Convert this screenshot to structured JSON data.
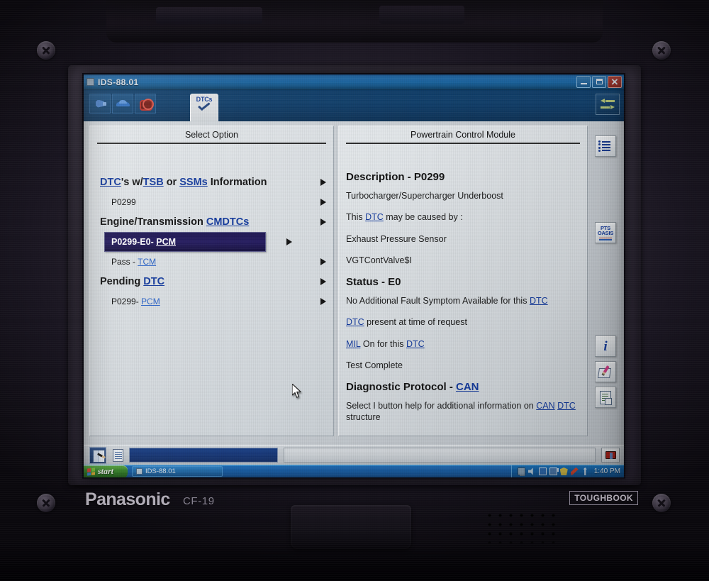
{
  "device": {
    "brand": "Panasonic",
    "model": "CF-19",
    "line": "TOUGHBOOK"
  },
  "window": {
    "title": "IDS-88.01",
    "controls": {
      "minimize": "minimize",
      "restore": "restore",
      "close": "close"
    }
  },
  "toolbar": {
    "buttons": [
      {
        "name": "vehicle-connection",
        "icon": "plug-icon"
      },
      {
        "name": "vehicle-select",
        "icon": "car-icon"
      },
      {
        "name": "engine-diagnostics",
        "icon": "engine-icon"
      }
    ],
    "tab": {
      "label": "DTCs",
      "icon": "checkmark-icon"
    },
    "nav": {
      "label": "back-forward",
      "icon": "back-forward-arrows-icon"
    }
  },
  "left_panel": {
    "title": "Select Option",
    "rows": [
      {
        "type": "head",
        "selected": false,
        "parts": [
          {
            "text": "DTC",
            "link": true
          },
          {
            "text": "'s w/",
            "link": false
          },
          {
            "text": "TSB",
            "link": true
          },
          {
            "text": " or ",
            "link": false
          },
          {
            "text": "SSMs",
            "link": true
          },
          {
            "text": " Information",
            "link": false
          }
        ]
      },
      {
        "type": "sub",
        "selected": false,
        "parts": [
          {
            "text": "P0299",
            "link": false
          }
        ]
      },
      {
        "type": "head",
        "selected": false,
        "parts": [
          {
            "text": "Engine/Transmission ",
            "link": false
          },
          {
            "text": "CMDTCs",
            "link": true
          }
        ]
      },
      {
        "type": "sub",
        "selected": true,
        "parts": [
          {
            "text": "P0299-E0- ",
            "link": false
          },
          {
            "text": "PCM",
            "link": true
          }
        ]
      },
      {
        "type": "sub",
        "selected": false,
        "parts": [
          {
            "text": "Pass - ",
            "link": false
          },
          {
            "text": "TCM",
            "link": true
          }
        ]
      },
      {
        "type": "head",
        "selected": false,
        "parts": [
          {
            "text": "Pending ",
            "link": false
          },
          {
            "text": "DTC",
            "link": true
          }
        ]
      },
      {
        "type": "sub",
        "selected": false,
        "parts": [
          {
            "text": "P0299- ",
            "link": false
          },
          {
            "text": "PCM",
            "link": true
          }
        ]
      }
    ]
  },
  "right_panel": {
    "title": "Powertrain Control Module",
    "blocks": [
      {
        "style": "heading",
        "parts": [
          {
            "text": "Description - P0299",
            "link": false
          }
        ]
      },
      {
        "style": "body",
        "parts": [
          {
            "text": "Turbocharger/Supercharger Underboost",
            "link": false
          }
        ]
      },
      {
        "style": "body",
        "parts": [
          {
            "text": "This ",
            "link": false
          },
          {
            "text": "DTC",
            "link": true
          },
          {
            "text": " may be caused by :",
            "link": false
          }
        ]
      },
      {
        "style": "body",
        "parts": [
          {
            "text": "Exhaust Pressure Sensor",
            "link": false
          }
        ]
      },
      {
        "style": "body",
        "parts": [
          {
            "text": "VGTContValve$I",
            "link": false
          }
        ]
      },
      {
        "style": "heading",
        "parts": [
          {
            "text": "Status - E0",
            "link": false
          }
        ]
      },
      {
        "style": "body",
        "parts": [
          {
            "text": "No Additional Fault Symptom Available for this ",
            "link": false
          },
          {
            "text": "DTC",
            "link": true
          }
        ]
      },
      {
        "style": "body",
        "parts": [
          {
            "text": "DTC",
            "link": true
          },
          {
            "text": " present at time of request",
            "link": false
          }
        ]
      },
      {
        "style": "body",
        "parts": [
          {
            "text": "MIL",
            "link": true
          },
          {
            "text": " On for this ",
            "link": false
          },
          {
            "text": "DTC",
            "link": true
          }
        ]
      },
      {
        "style": "body",
        "parts": [
          {
            "text": "Test Complete",
            "link": false
          }
        ]
      },
      {
        "style": "heading",
        "parts": [
          {
            "text": "Diagnostic Protocol - ",
            "link": false
          },
          {
            "text": "CAN",
            "link": true
          }
        ]
      },
      {
        "style": "body",
        "parts": [
          {
            "text": "Select I button help for additional information on ",
            "link": false
          },
          {
            "text": "CAN",
            "link": true
          },
          {
            "text": " ",
            "link": false
          },
          {
            "text": "DTC",
            "link": true
          },
          {
            "text": " structure",
            "link": false
          }
        ]
      }
    ]
  },
  "rail": {
    "buttons": [
      {
        "name": "list-view",
        "icon": "list-icon",
        "label": ""
      },
      {
        "name": "pts-oasis",
        "icon": "pts-oasis-icon",
        "label_line1": "PTS",
        "label_line2": "OASIS"
      },
      {
        "name": "information",
        "icon": "info-icon",
        "label": "i"
      },
      {
        "name": "notes",
        "icon": "notepad-pencil-icon",
        "label": ""
      },
      {
        "name": "report",
        "icon": "document-icon",
        "label": ""
      }
    ]
  },
  "statusbar": {
    "icons": [
      {
        "name": "manual",
        "icon": "book-pen-icon"
      },
      {
        "name": "document",
        "icon": "page-icon"
      }
    ],
    "progress_blue": "",
    "progress_gray": "",
    "alert": {
      "name": "vehicle-alert",
      "icon": "red-alert-icon"
    }
  },
  "taskbar": {
    "start": "start",
    "items": [
      {
        "label": "IDS-88.01",
        "icon": "window-icon"
      }
    ],
    "tray": [
      {
        "name": "display",
        "icon": "monitor-icon"
      },
      {
        "name": "volume",
        "icon": "speaker-icon"
      },
      {
        "name": "battery",
        "icon": "battery-icon"
      },
      {
        "name": "network",
        "icon": "network-icon"
      },
      {
        "name": "security",
        "icon": "shield-icon"
      },
      {
        "name": "utility",
        "icon": "wrench-icon"
      },
      {
        "name": "wireless",
        "icon": "wifi-icon"
      }
    ],
    "clock": "1:40 PM"
  },
  "colors": {
    "titlebar_blue": "#1c6dae",
    "toolbar_blue": "#113f6b",
    "panel_gray": "#d6dbdf",
    "link_blue": "#12399c",
    "selection_navy": "#231a5e",
    "taskbar_blue": "#1a62ad",
    "start_green": "#3f9031",
    "close_red": "#c2473c"
  }
}
